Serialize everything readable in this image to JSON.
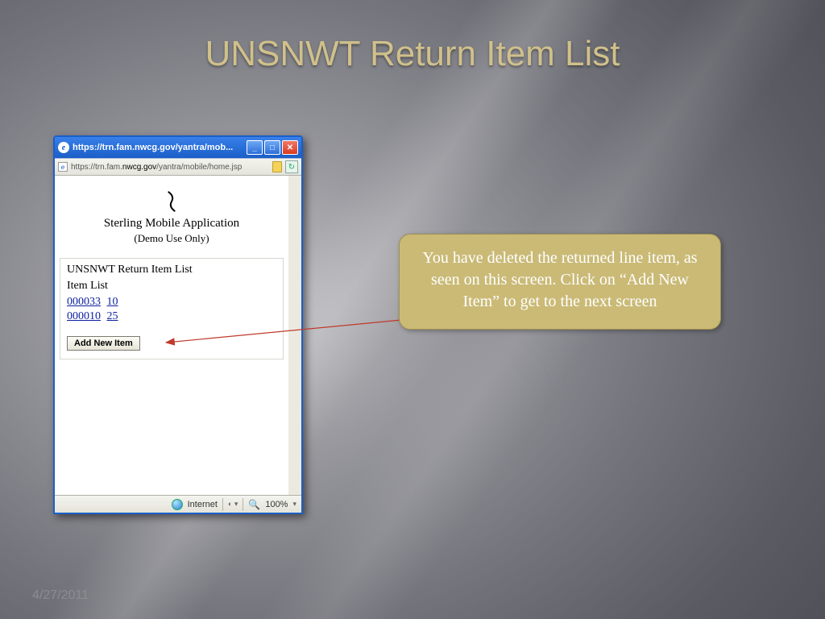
{
  "slide": {
    "title": "UNSNWT Return Item List",
    "date": "4/27/2011"
  },
  "window": {
    "title": "https://trn.fam.nwcg.gov/yantra/mob...",
    "url_pre": "https://trn.fam.",
    "url_domain": "nwcg.gov",
    "url_post": "/yantra/mobile/home.jsp"
  },
  "app": {
    "title": "Sterling Mobile Application",
    "subtitle": "(Demo Use Only)"
  },
  "panel": {
    "title": "UNSNWT Return Item List",
    "subtitle": "Item List",
    "items": [
      {
        "id": "000033",
        "qty": "10"
      },
      {
        "id": "000010",
        "qty": "25"
      }
    ],
    "add_button": "Add New Item"
  },
  "status": {
    "zone": "Internet",
    "zoom": "100%"
  },
  "callout": {
    "text": "You have deleted the returned line item, as seen on this screen. Click on “Add New Item” to get to the next screen"
  }
}
